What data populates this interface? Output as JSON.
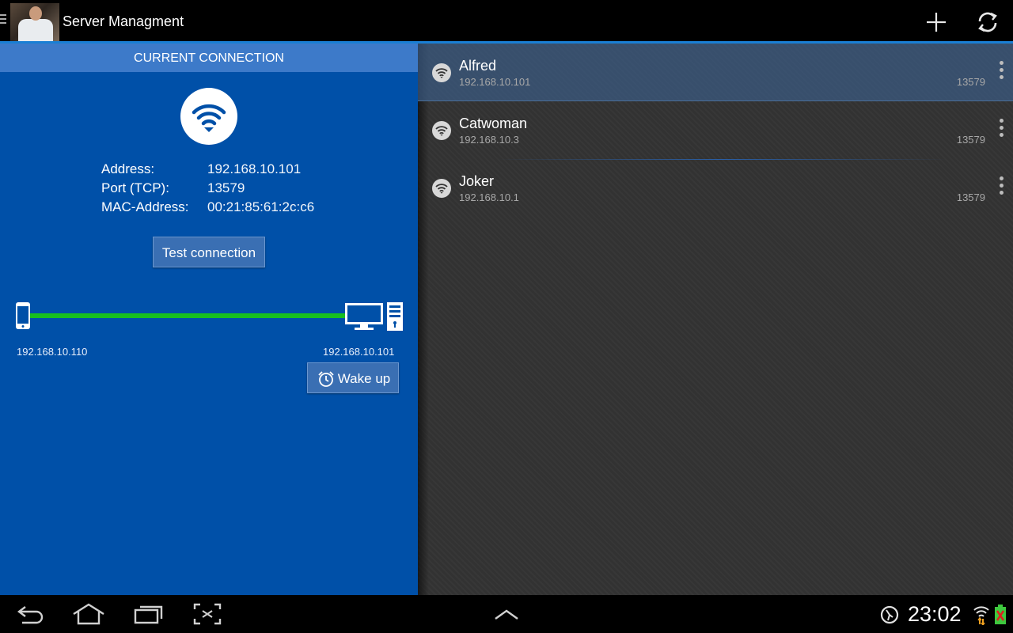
{
  "app": {
    "title": "Server Managment"
  },
  "current": {
    "header": "CURRENT CONNECTION",
    "address_label": "Address:",
    "address": "192.168.10.101",
    "port_label": "Port (TCP):",
    "port": "13579",
    "mac_label": "MAC-Address:",
    "mac": "00:21:85:61:2c:c6",
    "test_button": "Test connection",
    "local_ip": "192.168.10.110",
    "remote_ip": "192.168.10.101",
    "wake_button": "Wake up"
  },
  "servers": [
    {
      "name": "Alfred",
      "ip": "192.168.10.101",
      "port": "13579",
      "selected": true
    },
    {
      "name": "Catwoman",
      "ip": "192.168.10.3",
      "port": "13579",
      "selected": false
    },
    {
      "name": "Joker",
      "ip": "192.168.10.1",
      "port": "13579",
      "selected": false
    }
  ],
  "system": {
    "clock": "23:02"
  },
  "colors": {
    "panel_blue": "#0050a8",
    "header_blue": "#3d7ac9",
    "link_green": "#17c01f",
    "accent": "#1a7fd4"
  },
  "icons": [
    "menu-icon",
    "add-icon",
    "refresh-icon",
    "wifi-icon",
    "phone-icon",
    "monitor-icon",
    "tower-icon",
    "alarm-clock-icon",
    "overflow-menu-icon",
    "back-icon",
    "home-icon",
    "recent-apps-icon",
    "screenshot-icon",
    "up-arrow-icon",
    "gps-icon",
    "signal-icon",
    "battery-icon"
  ]
}
